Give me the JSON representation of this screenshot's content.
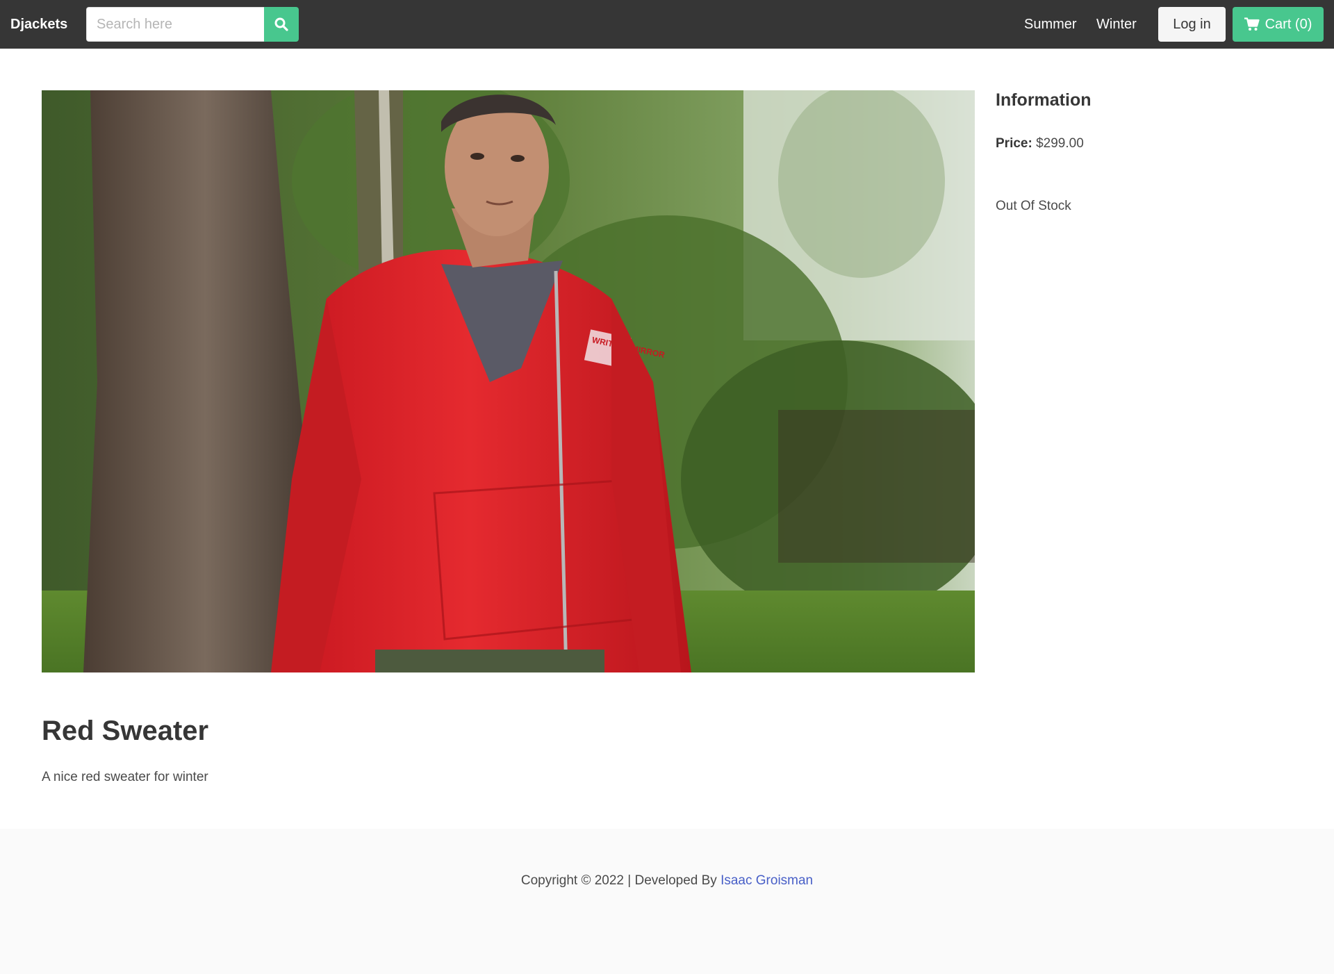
{
  "navbar": {
    "brand": "Djackets",
    "search_placeholder": "Search here",
    "links": [
      "Summer",
      "Winter"
    ],
    "login_label": "Log in",
    "cart_label": "Cart (0)",
    "colors": {
      "background": "#363636",
      "accent": "#48c78e"
    }
  },
  "product": {
    "name": "Red Sweater",
    "description": "A nice red sweater for winter",
    "image_alt": "Man wearing a red zip-up hoodie outdoors by a tree",
    "image_printed_text": "WRITTEN MIRROR"
  },
  "info": {
    "title": "Information",
    "price_label": "Price:",
    "price_value": "$299.00",
    "stock_status": "Out Of Stock"
  },
  "footer": {
    "text": "Copyright © 2022 | Developed By ",
    "link_text": "Isaac Groisman",
    "link_color": "#485fc7"
  }
}
